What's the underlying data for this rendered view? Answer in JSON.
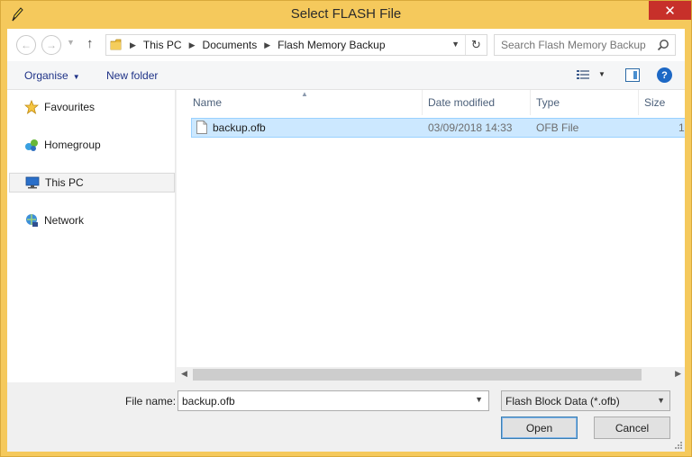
{
  "window": {
    "title": "Select FLASH File",
    "close_glyph": "✕"
  },
  "address": {
    "crumbs": [
      "This PC",
      "Documents",
      "Flash Memory Backup"
    ],
    "search_placeholder": "Search Flash Memory Backup"
  },
  "toolbar": {
    "organise": "Organise",
    "new_folder": "New folder",
    "help_glyph": "?"
  },
  "navpane": {
    "items": [
      "Favourites",
      "Homegroup",
      "This PC",
      "Network"
    ],
    "selected": "This PC"
  },
  "filelist": {
    "columns": [
      "Name",
      "Date modified",
      "Type",
      "Size"
    ],
    "rows": [
      {
        "name": "backup.ofb",
        "date": "03/09/2018 14:33",
        "type": "OFB File",
        "size": "1"
      }
    ]
  },
  "bottom": {
    "filename_label": "File name:",
    "filename_value": "backup.ofb",
    "filter": "Flash Block Data (*.ofb)",
    "open": "Open",
    "cancel": "Cancel"
  },
  "icons": [
    "pen-icon",
    "back-icon",
    "forward-icon",
    "up-arrow-icon",
    "folder-icon",
    "refresh-icon",
    "search-icon",
    "star-icon",
    "homegroup-icon",
    "computer-icon",
    "network-icon",
    "file-icon"
  ]
}
